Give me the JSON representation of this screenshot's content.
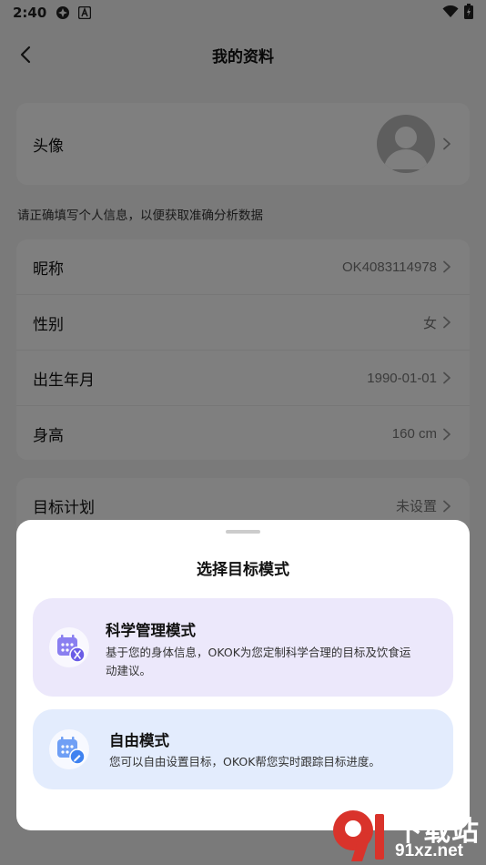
{
  "status_bar": {
    "time": "2:40"
  },
  "header": {
    "title": "我的资料"
  },
  "avatar_row": {
    "label": "头像"
  },
  "hint": "请正确填写个人信息，以便获取准确分析数据",
  "profile_rows": [
    {
      "label": "昵称",
      "value": "OK4083114978"
    },
    {
      "label": "性别",
      "value": "女"
    },
    {
      "label": "出生年月",
      "value": "1990-01-01"
    },
    {
      "label": "身高",
      "value": "160 cm"
    }
  ],
  "goal_row": {
    "label": "目标计划",
    "value": "未设置"
  },
  "sheet": {
    "title": "选择目标模式",
    "options": [
      {
        "title": "科学管理模式",
        "desc_line1": "基于您的身体信息，OKOK为您定制科学合理的目标及饮食运",
        "desc_line2": "动建议。",
        "bg": "#ece8fb",
        "icon_color": "#8a7ff0"
      },
      {
        "title": "自由模式",
        "desc_line1": "您可以自由设置目标，OKOK帮您实时跟踪目标进度。",
        "bg": "#e3ecfd",
        "icon_color": "#6f9ff5"
      }
    ]
  },
  "watermark": {
    "line1": "下载站",
    "line2": "91xz.net",
    "accent": "#d9332b"
  }
}
